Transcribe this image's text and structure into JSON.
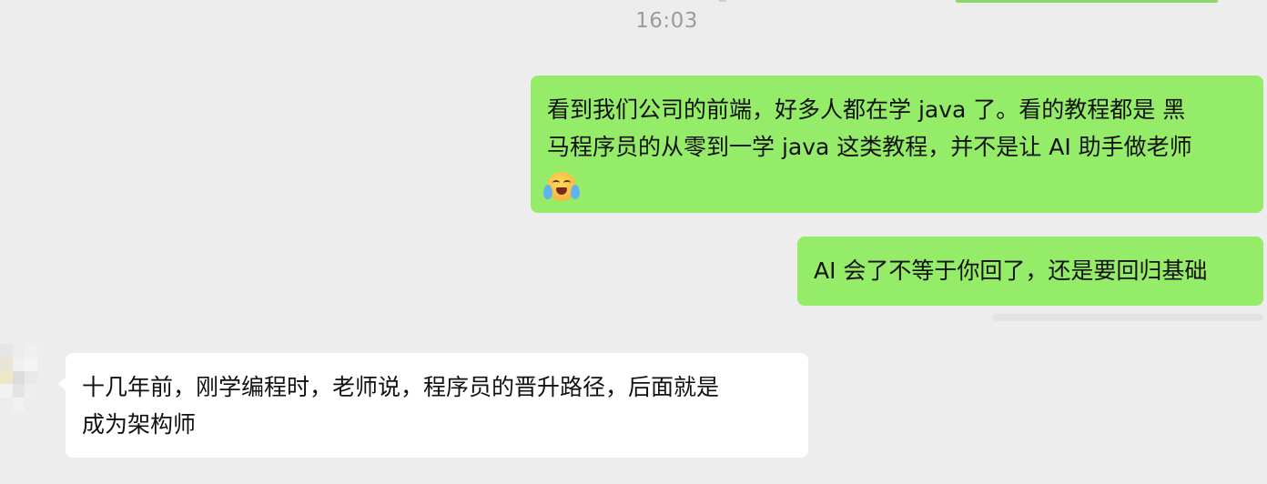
{
  "timestamp": "16:03",
  "messages": [
    {
      "direction": "outgoing",
      "lines": [
        "看到我们公司的前端，好多人都在学 java 了。看的教程都是  黑",
        "马程序员的从零到一学 java 这类教程，并不是让 AI 助手做老师"
      ],
      "emoji": "crying-laughing-face-icon"
    },
    {
      "direction": "outgoing",
      "text": "AI 会了不等于你回了，还是要回归基础"
    },
    {
      "direction": "incoming",
      "lines": [
        "十几年前，刚学编程时，老师说，程序员的晋升路径，后面就是",
        "成为架构师"
      ]
    }
  ],
  "colors": {
    "background": "#ededed",
    "outgoing_bubble": "#95ec69",
    "incoming_bubble": "#ffffff",
    "timestamp_text": "#9b9b9b"
  }
}
